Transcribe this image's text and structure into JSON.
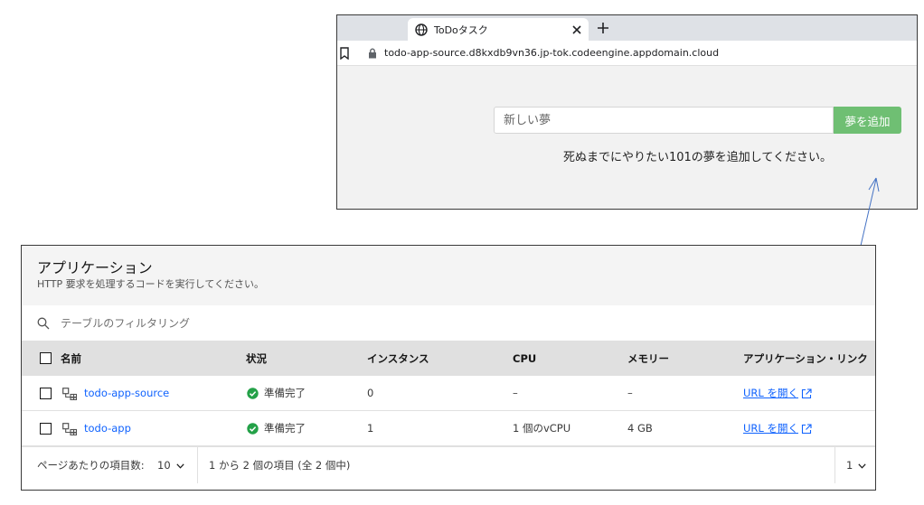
{
  "browser": {
    "tab_title": "ToDoタスク",
    "url": "todo-app-source.d8kxdb9vn36.jp-tok.codeengine.appdomain.cloud"
  },
  "todo": {
    "input_placeholder": "新しい夢",
    "input_value": "",
    "add_button": "夢を追加",
    "hint": "死ぬまでにやりたい101の夢を追加してください。",
    "accent_color": "#6fbf73"
  },
  "apps": {
    "title": "アプリケーション",
    "subtitle": "HTTP 要求を処理するコードを実行してください。",
    "search_placeholder": "テーブルのフィルタリング",
    "columns": {
      "name": "名前",
      "status": "状況",
      "instances": "インスタンス",
      "cpu": "CPU",
      "memory": "メモリー",
      "link": "アプリケーション・リンク"
    },
    "rows": [
      {
        "name": "todo-app-source",
        "status": "準備完了",
        "instances": "0",
        "cpu": "–",
        "memory": "–",
        "link": "URL を開く"
      },
      {
        "name": "todo-app",
        "status": "準備完了",
        "instances": "1",
        "cpu": "1 個のvCPU",
        "memory": "4 GB",
        "link": "URL を開く"
      }
    ],
    "pagination": {
      "per_page_label": "ページあたりの項目数:",
      "per_page_value": "10",
      "range_text": "1 から 2 個の項目 (全 2 個中)",
      "page_value": "1"
    },
    "status_color": "#24a148",
    "link_color": "#0f62fe"
  }
}
